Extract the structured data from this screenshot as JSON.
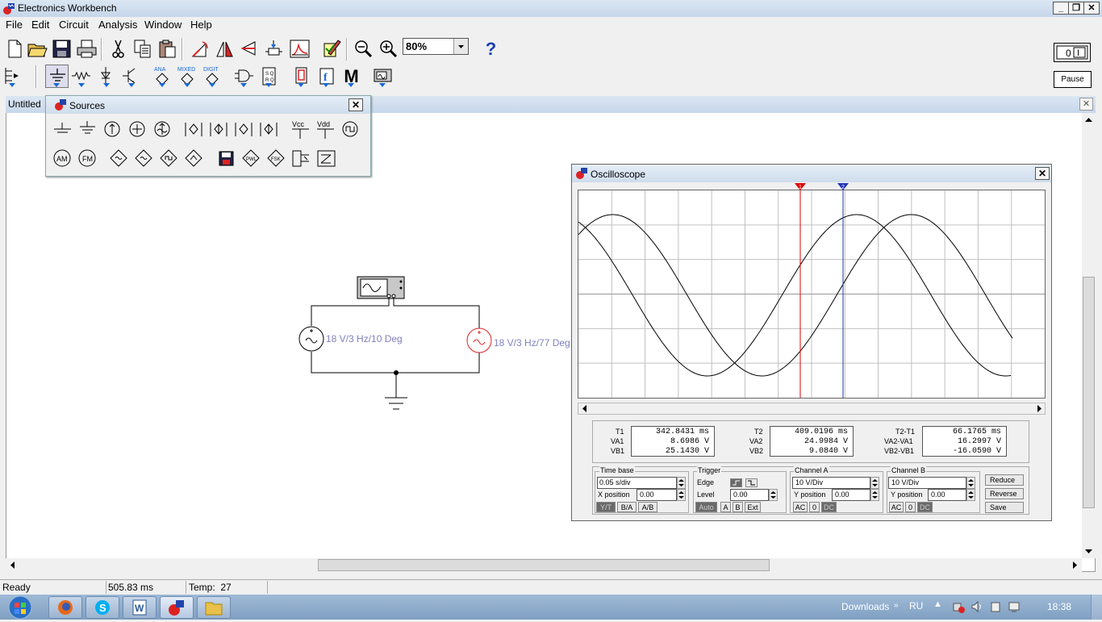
{
  "window": {
    "title": "Electronics Workbench"
  },
  "menu": [
    "File",
    "Edit",
    "Circuit",
    "Analysis",
    "Window",
    "Help"
  ],
  "toolbar": {
    "zoom": "80%",
    "help_label": "?",
    "pause_label": "Pause",
    "parts_labels": {
      "analog": "ANA",
      "mixed": "MIXED",
      "digital": "DIGIT",
      "misc": "M"
    }
  },
  "document": {
    "title": "Untitled"
  },
  "sources_window": {
    "title": "Sources",
    "vcc_label": "Vcc",
    "vdd_label": "Vdd",
    "am_label": "AM",
    "fm_label": "FM"
  },
  "circuit": {
    "source1_label": "18 V/3 Hz/10 Deg",
    "source2_label": "18 V/3 Hz/77 Deg"
  },
  "oscilloscope": {
    "title": "Oscilloscope",
    "cursor1_label": "1",
    "cursor2_label": "2",
    "readouts": {
      "t1_label": "T1",
      "t1": "342.8431 ms",
      "va1_label": "VA1",
      "va1": "8.6986 V",
      "vb1_label": "VB1",
      "vb1": "25.1430 V",
      "t2_label": "T2",
      "t2": "409.0196 ms",
      "va2_label": "VA2",
      "va2": "24.9984 V",
      "vb2_label": "VB2",
      "vb2": "9.0840 V",
      "dt_label": "T2-T1",
      "dt": "66.1765 ms",
      "dva_label": "VA2-VA1",
      "dva": "16.2997 V",
      "dvb_label": "VB2-VB1",
      "dvb": "-16.0590 V"
    },
    "timebase": {
      "label": "Time base",
      "value": "0.05 s/div",
      "xpos_label": "X position",
      "xpos": "0.00",
      "modes": [
        "Y/T",
        "B/A",
        "A/B"
      ]
    },
    "trigger": {
      "label": "Trigger",
      "edge_label": "Edge",
      "level_label": "Level",
      "level": "0.00",
      "modes": [
        "Auto",
        "A",
        "B",
        "Ext"
      ]
    },
    "channel_a": {
      "label": "Channel A",
      "value": "10 V/Div",
      "ypos_label": "Y position",
      "ypos": "0.00",
      "coupling": [
        "AC",
        "0",
        "DC"
      ]
    },
    "channel_b": {
      "label": "Channel B",
      "value": "10 V/Div",
      "ypos_label": "Y position",
      "ypos": "0.00",
      "coupling": [
        "AC",
        "0",
        "DC"
      ]
    },
    "buttons": {
      "reduce": "Reduce",
      "reverse": "Reverse",
      "save": "Save"
    }
  },
  "status": {
    "state": "Ready",
    "time": "505.83 ms",
    "temp": "Temp:  27"
  },
  "taskbar": {
    "downloads": "Downloads",
    "lang": "RU",
    "clock": "18:38"
  },
  "colors": {
    "accent": "#1769d8",
    "source2": "#dd2222",
    "label": "#8080c0",
    "cursor1": "#dd0000",
    "cursor2": "#2233bb"
  }
}
